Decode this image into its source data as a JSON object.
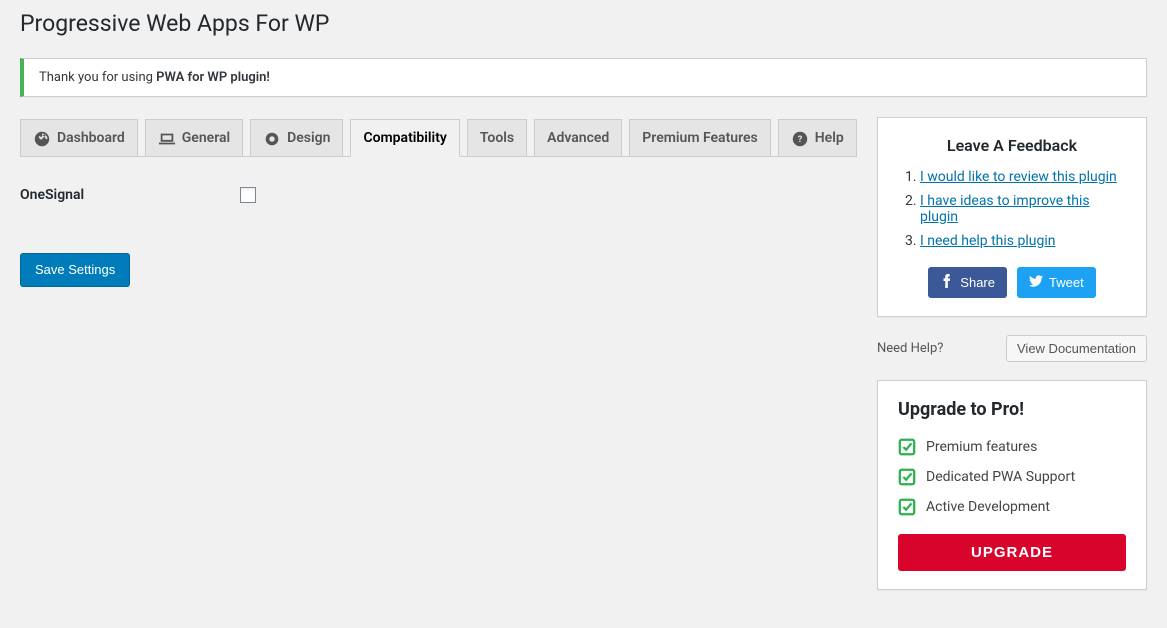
{
  "page": {
    "title": "Progressive Web Apps For WP"
  },
  "notice": {
    "prefix": "Thank you for using ",
    "bold": "PWA for WP plugin!"
  },
  "tabs": [
    {
      "label": "Dashboard"
    },
    {
      "label": "General"
    },
    {
      "label": "Design"
    },
    {
      "label": "Compatibility"
    },
    {
      "label": "Tools"
    },
    {
      "label": "Advanced"
    },
    {
      "label": "Premium Features"
    },
    {
      "label": "Help"
    }
  ],
  "form": {
    "onesignal_label": "OneSignal",
    "save_label": "Save Settings"
  },
  "feedback": {
    "title": "Leave A Feedback",
    "items": [
      "I would like to review this plugin",
      "I have ideas to improve this plugin",
      "I need help this plugin"
    ],
    "share_label": "Share",
    "tweet_label": "Tweet"
  },
  "help": {
    "label": "Need Help?",
    "button": "View Documentation"
  },
  "pro": {
    "title": "Upgrade to Pro!",
    "features": [
      "Premium features",
      "Dedicated PWA Support",
      "Active Development"
    ],
    "button": "UPGRADE"
  }
}
